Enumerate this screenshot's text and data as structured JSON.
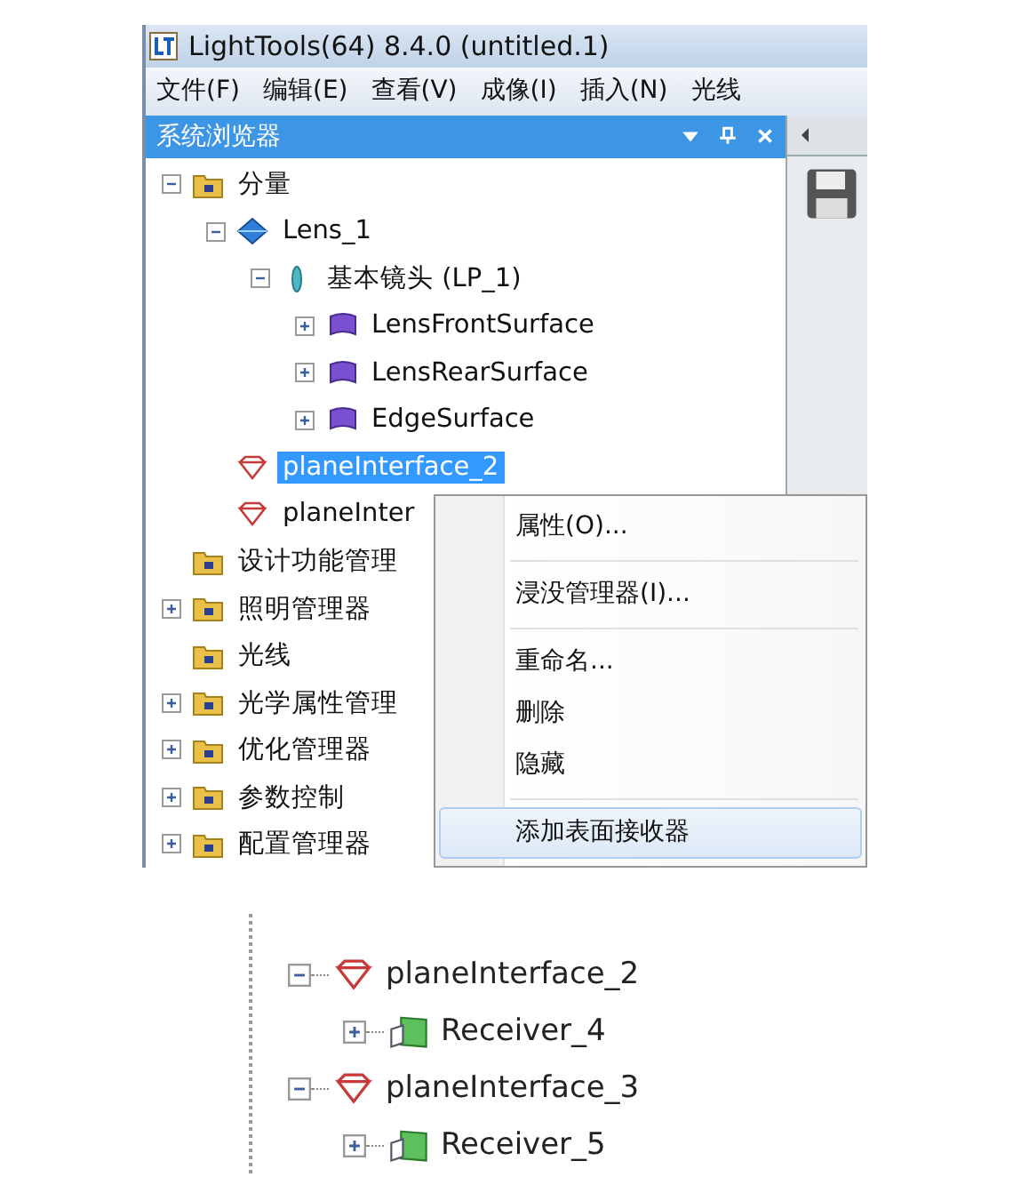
{
  "window": {
    "title": "LightTools(64) 8.4.0  (untitled.1)"
  },
  "menu_bar": [
    "文件(F)",
    "编辑(E)",
    "查看(V)",
    "成像(I)",
    "插入(N)",
    "光线"
  ],
  "browser": {
    "title": "系统浏览器",
    "tree": [
      {
        "label": "分量",
        "kind": "folder",
        "expanded": true,
        "selected": false,
        "children": [
          {
            "label": "Lens_1",
            "kind": "lens-body",
            "expanded": true,
            "selected": false,
            "children": [
              {
                "label": "基本镜头 (LP_1)",
                "kind": "lens",
                "expanded": true,
                "selected": false,
                "children": [
                  {
                    "label": "LensFrontSurface",
                    "kind": "surface",
                    "expanded": false,
                    "selected": false
                  },
                  {
                    "label": "LensRearSurface",
                    "kind": "surface",
                    "expanded": false,
                    "selected": false
                  },
                  {
                    "label": "EdgeSurface",
                    "kind": "surface",
                    "expanded": false,
                    "selected": false
                  }
                ]
              }
            ]
          },
          {
            "label": "planeInterface_2",
            "kind": "interface",
            "selected": true
          },
          {
            "label": "planeInter",
            "kind": "interface",
            "selected": false
          }
        ]
      },
      {
        "label": "设计功能管理",
        "kind": "folder",
        "selected": false
      },
      {
        "label": "照明管理器",
        "kind": "folder",
        "expanded": false,
        "selected": false
      },
      {
        "label": "光线",
        "kind": "folder",
        "selected": false
      },
      {
        "label": "光学属性管理",
        "kind": "folder",
        "expanded": false,
        "selected": false
      },
      {
        "label": "优化管理器",
        "kind": "folder",
        "expanded": false,
        "selected": false
      },
      {
        "label": "参数控制",
        "kind": "folder",
        "expanded": false,
        "selected": false
      },
      {
        "label": "配置管理器",
        "kind": "folder",
        "expanded": false,
        "selected": false
      }
    ]
  },
  "context_menu": [
    {
      "kind": "item",
      "label": "属性(O)...",
      "selected": false
    },
    {
      "kind": "separator"
    },
    {
      "kind": "item",
      "label": "浸没管理器(I)...",
      "selected": false
    },
    {
      "kind": "separator"
    },
    {
      "kind": "item",
      "label": "重命名...",
      "selected": false
    },
    {
      "kind": "item",
      "label": "删除",
      "selected": false
    },
    {
      "kind": "item",
      "label": "隐藏",
      "selected": false
    },
    {
      "kind": "separator"
    },
    {
      "kind": "item",
      "label": "添加表面接收器",
      "selected": true
    }
  ],
  "detail_tree": [
    {
      "label": "planeInterface_2",
      "kind": "interface",
      "expanded": true,
      "children": [
        {
          "label": "Receiver_4",
          "kind": "receiver",
          "expanded": false
        }
      ]
    },
    {
      "label": "planeInterface_3",
      "kind": "interface",
      "expanded": true,
      "children": [
        {
          "label": "Receiver_5",
          "kind": "receiver",
          "expanded": false
        }
      ]
    }
  ]
}
